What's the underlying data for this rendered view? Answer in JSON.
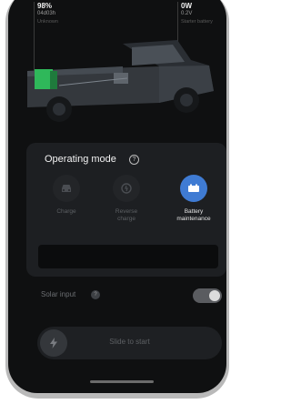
{
  "stats": {
    "left": {
      "value": "98%",
      "sub": "04d03h",
      "meta": "Unknown"
    },
    "right": {
      "value": "0W",
      "sub": "0.2V",
      "meta": "Starter battery"
    }
  },
  "operating_mode": {
    "title": "Operating mode",
    "modes": [
      {
        "label": "Charge",
        "icon": "car-icon",
        "active": false
      },
      {
        "label": "Reverse\ncharge",
        "icon": "reverse-charge-icon",
        "active": false
      },
      {
        "label": "Battery\nmaintenance",
        "icon": "battery-icon",
        "active": true
      }
    ]
  },
  "solar_input": {
    "label": "Solar input",
    "enabled": true
  },
  "slide": {
    "label": "Slide to start"
  },
  "colors": {
    "accent": "#3f7bd3",
    "battery_green": "#2fb85a"
  }
}
